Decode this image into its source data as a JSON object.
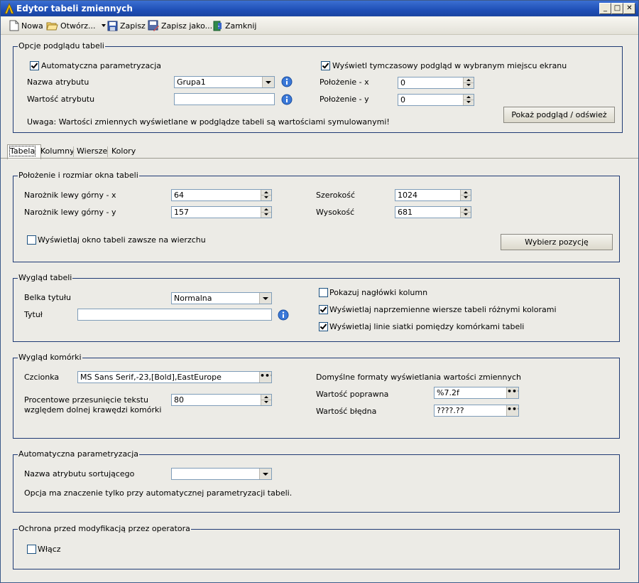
{
  "window": {
    "title": "Edytor tabeli zmiennych",
    "min": "_",
    "max": "□",
    "close": "✕"
  },
  "toolbar": {
    "new": "Nowa",
    "open": "Otwórz...",
    "save": "Zapisz",
    "save_as": "Zapisz jako...",
    "close": "Zamknij"
  },
  "preview": {
    "legend": "Opcje podglądu tabeli",
    "auto_param": "Automatyczna parametryzacja",
    "temp_preview": "Wyświetl tymczasowy podgląd w wybranym miejscu ekranu",
    "attr_name_label": "Nazwa atrybutu",
    "attr_name_value": "Grupa1",
    "attr_value_label": "Wartość atrybutu",
    "attr_value_value": "",
    "pos_x_label": "Położenie - x",
    "pos_x_value": "0",
    "pos_y_label": "Położenie - y",
    "pos_y_value": "0",
    "show_button": "Pokaż podgląd / odśwież",
    "note": "Uwaga: Wartości zmiennych wyświetlane w podglądze tabeli są wartościami symulowanymi!"
  },
  "tabs": [
    "Tabela",
    "Kolumny",
    "Wiersze",
    "Kolory"
  ],
  "position": {
    "legend": "Położenie i rozmiar okna tabeli",
    "tl_x_label": "Narożnik lewy górny - x",
    "tl_x_value": "64",
    "tl_y_label": "Narożnik lewy górny - y",
    "tl_y_value": "157",
    "width_label": "Szerokość",
    "width_value": "1024",
    "height_label": "Wysokość",
    "height_value": "681",
    "on_top": "Wyświetlaj okno tabeli zawsze na wierzchu",
    "choose_button": "Wybierz pozycję"
  },
  "look": {
    "legend": "Wygląd tabeli",
    "titlebar_label": "Belka tytułu",
    "titlebar_value": "Normalna",
    "title_label": "Tytuł",
    "title_value": "",
    "show_headers": "Pokazuj nagłówki kolumn",
    "alt_rows": "Wyświetlaj naprzemienne wiersze tabeli różnymi kolorami",
    "grid_lines": "Wyświetlaj linie siatki pomiędzy komórkami tabeli"
  },
  "cell": {
    "legend": "Wygląd komórki",
    "font_label": "Czcionka",
    "font_value": "MS Sans Serif,-23,[Bold],EastEurope",
    "offset_label_1": "Procentowe przesunięcie tekstu",
    "offset_label_2": "względem dolnej krawędzi komórki",
    "offset_value": "80",
    "formats_title": "Domyślne formaty wyświetlania wartości zmiennych",
    "valid_label": "Wartość poprawna",
    "valid_value": "%7.2f",
    "invalid_label": "Wartość błędna",
    "invalid_value": "????.??"
  },
  "autoparam": {
    "legend": "Automatyczna parametryzacja",
    "sort_label": "Nazwa atrybutu sortującego",
    "sort_value": "",
    "note": "Opcja ma znaczenie tylko przy automatycznej parametryzacji tabeli."
  },
  "protect": {
    "legend": "Ochrona przed modyfikacją przez operatora",
    "enable": "Włącz"
  },
  "ellipsis": "•••"
}
